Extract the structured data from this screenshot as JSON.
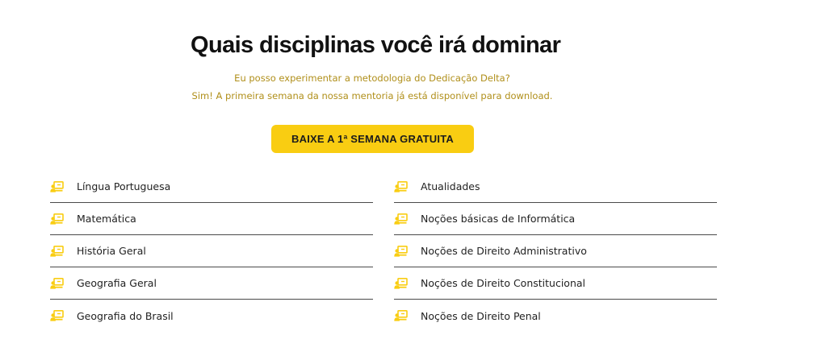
{
  "header": {
    "title": "Quais disciplinas você irá dominar",
    "subtitle_line1": "Eu posso experimentar a metodologia do Dedicação Delta?",
    "subtitle_line2": "Sim! A primeira semana da nossa mentoria já está disponível para download."
  },
  "cta": {
    "label": "BAIXE A 1ª SEMANA GRATUITA"
  },
  "colors": {
    "accent": "#f9cd12",
    "subtitle": "#b08f1a",
    "title": "#111111",
    "divider": "#4a4a4a"
  },
  "icon": "teacher-board-icon",
  "subjects_left": [
    {
      "label": "Língua Portuguesa"
    },
    {
      "label": "Matemática"
    },
    {
      "label": "História Geral"
    },
    {
      "label": "Geografia Geral"
    },
    {
      "label": "Geografia do Brasil"
    }
  ],
  "subjects_right": [
    {
      "label": "Atualidades"
    },
    {
      "label": "Noções básicas de Informática"
    },
    {
      "label": "Noções de Direito Administrativo"
    },
    {
      "label": "Noções de Direito Constitucional"
    },
    {
      "label": "Noções de Direito Penal"
    }
  ]
}
